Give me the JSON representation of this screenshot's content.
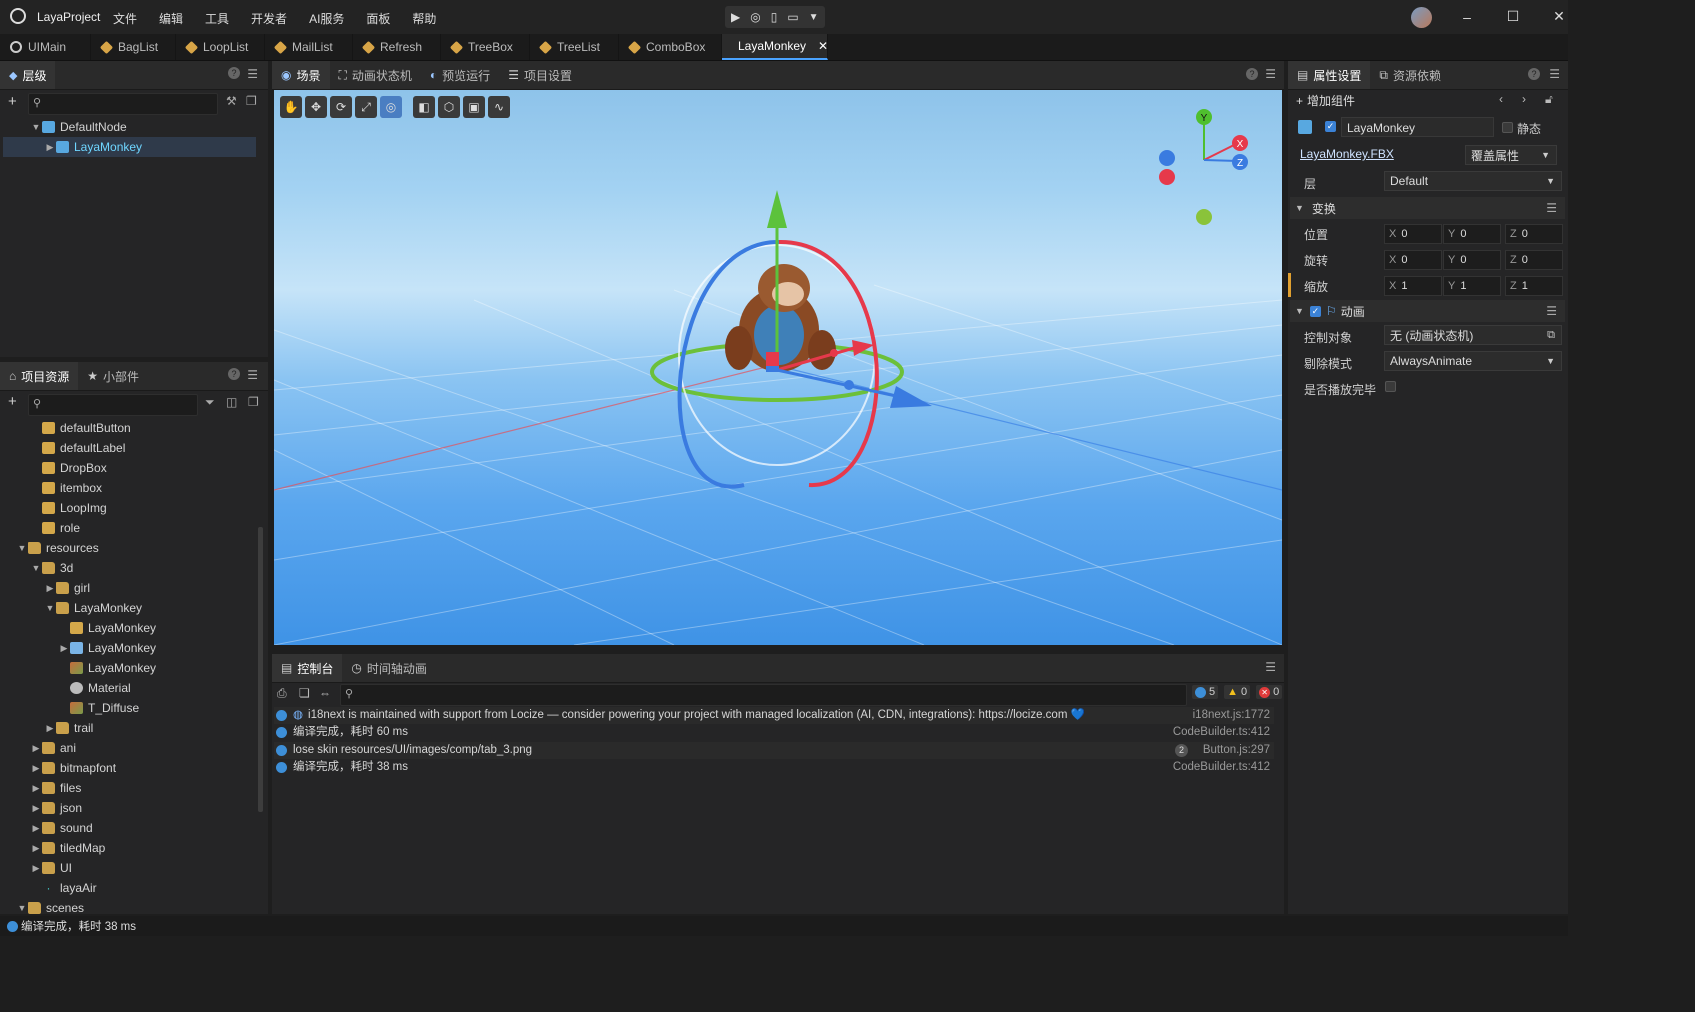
{
  "app": {
    "title": "LayaProject",
    "menu": [
      "文件",
      "编辑",
      "工具",
      "开发者",
      "AI服务",
      "面板",
      "帮助"
    ]
  },
  "doc_tabs": [
    "UIMain",
    "BagList",
    "LoopList",
    "MailList",
    "Refresh",
    "TreeBox",
    "TreeList",
    "ComboBox",
    "LayaMonkey"
  ],
  "hierarchy": {
    "tab": "层级",
    "nodes": [
      {
        "label": "DefaultNode"
      },
      {
        "label": "LayaMonkey"
      }
    ]
  },
  "assets": {
    "tabs": [
      "项目资源",
      "小部件"
    ],
    "items": [
      "defaultButton",
      "defaultLabel",
      "DropBox",
      "itembox",
      "LoopImg",
      "role",
      "resources",
      "3d",
      "girl",
      "LayaMonkey",
      "LayaMonkey",
      "LayaMonkey",
      "LayaMonkey",
      "Material",
      "T_Diffuse",
      "trail",
      "ani",
      "bitmapfont",
      "files",
      "json",
      "sound",
      "tiledMap",
      "UI",
      "layaAir",
      "scenes"
    ]
  },
  "center_tabs": [
    "场景",
    "动画状态机",
    "预览运行",
    "项目设置"
  ],
  "gizmo_axes": [
    "Y",
    "X",
    "Z"
  ],
  "console": {
    "tabs": [
      "控制台",
      "时间轴动画"
    ],
    "counts": {
      "info": "5",
      "warn": "0",
      "error": "0"
    },
    "logs": [
      {
        "text": "i18next is maintained with support from Locize — consider powering your project with managed localization (AI, CDN, integrations): https://locize.com 💙",
        "src": "i18next.js:1772"
      },
      {
        "text": "编译完成，耗时 60 ms",
        "src": "CodeBuilder.ts:412"
      },
      {
        "text": "lose skin resources/UI/images/comp/tab_3.png",
        "src": "Button.js:297",
        "badge": "2"
      },
      {
        "text": "编译完成，耗时 38 ms",
        "src": "CodeBuilder.ts:412"
      }
    ]
  },
  "inspector": {
    "tabs": [
      "属性设置",
      "资源依赖"
    ],
    "add_component": "增加组件",
    "node_name": "LayaMonkey",
    "static_label": "静态",
    "fbx_link": "LayaMonkey.FBX",
    "override_btn": "覆盖属性",
    "layer_label": "层",
    "layer_value": "Default",
    "transform": {
      "title": "变换",
      "position": {
        "label": "位置",
        "x": "0",
        "y": "0",
        "z": "0"
      },
      "rotation": {
        "label": "旋转",
        "x": "0",
        "y": "0",
        "z": "0"
      },
      "scale": {
        "label": "缩放",
        "x": "1",
        "y": "1",
        "z": "1"
      }
    },
    "animation": {
      "title": "动画",
      "controller_label": "控制对象",
      "controller_value": "无 (动画状态机)",
      "cull_label": "剔除模式",
      "cull_value": "AlwaysAnimate",
      "play_label": "是否播放完毕"
    }
  },
  "status_bar": "编译完成，耗时 38 ms"
}
